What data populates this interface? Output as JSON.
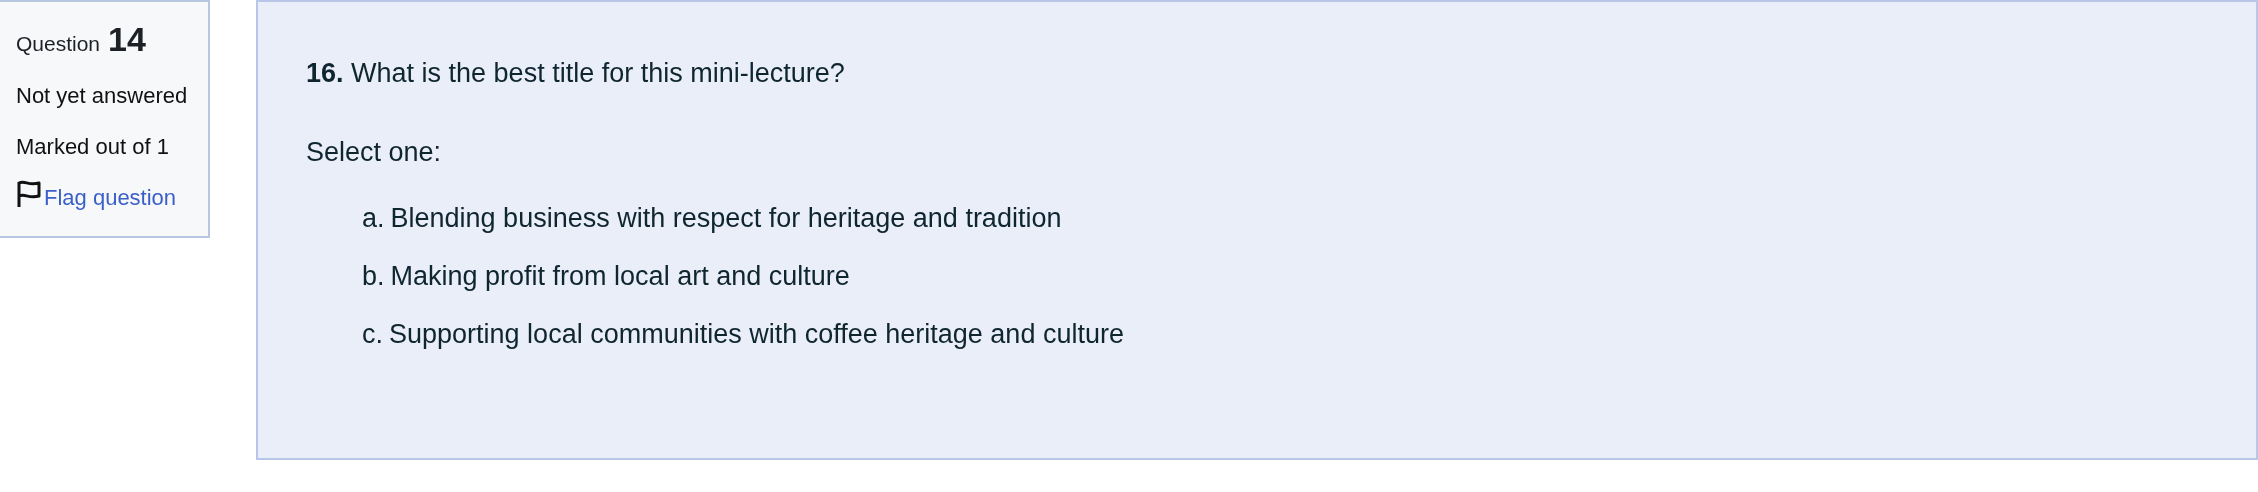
{
  "question_info": {
    "label": "Question",
    "number": "14",
    "status": "Not yet answered",
    "grade": "Marked out of 1",
    "flag_link": "Flag question"
  },
  "question": {
    "number": "16.",
    "text": "What is the best title for this mini-lecture?",
    "prompt": "Select one:",
    "options": [
      {
        "letter": "a.",
        "text": "Blending business with respect for heritage and tradition"
      },
      {
        "letter": "b.",
        "text": "Making profit from local art and culture"
      },
      {
        "letter": "c.",
        "text": "Supporting local communities with coffee heritage and culture"
      }
    ]
  }
}
